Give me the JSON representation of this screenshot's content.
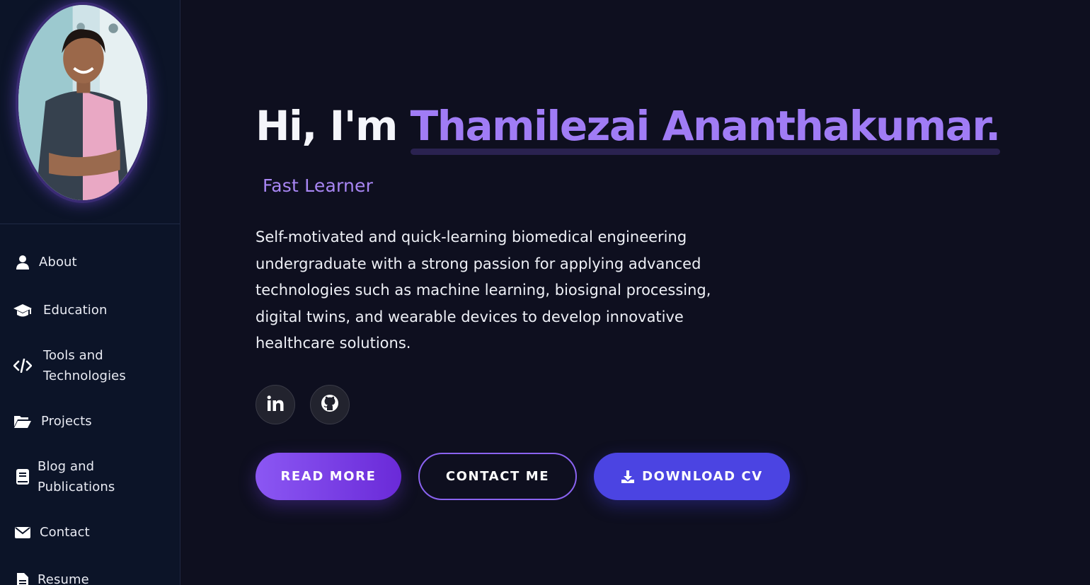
{
  "colors": {
    "background": "#0e0f1f",
    "sidebar": "#0c1428",
    "accent": "#a07cf5",
    "download_button": "#4b44e2"
  },
  "sidebar": {
    "avatar_icon": "profile-photo",
    "items": [
      {
        "label": "About",
        "icon": "user-icon"
      },
      {
        "label": "Education",
        "icon": "graduation-cap-icon"
      },
      {
        "label": "Tools and Technologies",
        "icon": "code-icon"
      },
      {
        "label": "Projects",
        "icon": "folder-open-icon"
      },
      {
        "label": "Blog and Publications",
        "icon": "book-icon"
      },
      {
        "label": "Contact",
        "icon": "envelope-icon"
      },
      {
        "label": "Resume",
        "icon": "file-icon"
      }
    ]
  },
  "hero": {
    "greeting": "Hi, I'm ",
    "name": "Thamilezai Ananthakumar.",
    "subtitle": "Fast Learner",
    "bio": "Self-motivated and quick-learning biomedical engineering undergraduate with a strong passion for applying advanced technologies such as machine learning, biosignal processing, digital twins, and wearable devices to develop innovative healthcare solutions."
  },
  "social": [
    {
      "icon": "linkedin-icon"
    },
    {
      "icon": "github-icon"
    }
  ],
  "buttons": {
    "read_more": "READ MORE",
    "contact_me": "CONTACT ME",
    "download_cv": "DOWNLOAD CV",
    "download_icon": "download-icon"
  }
}
